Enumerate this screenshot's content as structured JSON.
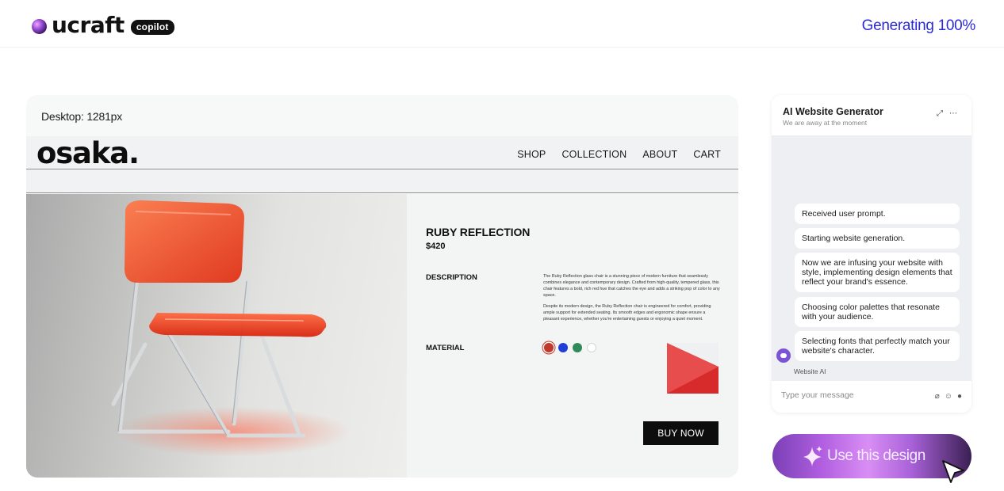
{
  "brand": {
    "name": "ucraft",
    "badge": "copilot"
  },
  "status": {
    "text": "Generating 100%"
  },
  "preview": {
    "label": "Desktop: 1281px",
    "site": {
      "logo": "osaka.",
      "nav": [
        "SHOP",
        "COLLECTION",
        "ABOUT",
        "CART"
      ]
    },
    "product": {
      "name": "RUBY REFLECTION",
      "price": "$420",
      "description_label": "DESCRIPTION",
      "description": [
        "The Ruby Reflection glass chair is a stunning piece of modern furniture that seamlessly combines elegance and contemporary design. Crafted from high-quality, tempered glass, this chair features a bold, rich red hue that catches the eye and adds a striking pop of color to any space.",
        "Despite its modern design, the Ruby Reflection chair is engineered for comfort, providing ample support for extended seating. Its smooth edges and ergonomic shape ensure a pleasant experience, whether you're entertaining guests or enjoying a quiet moment."
      ],
      "material_label": "MATERIAL",
      "swatches": [
        "#c0392b",
        "#1f3fd8",
        "#2e8b57",
        "#ffffff"
      ],
      "buy_label": "BUY NOW"
    }
  },
  "chat": {
    "title": "AI Website Generator",
    "subtitle": "We are away at the moment",
    "messages": [
      "Received user prompt.",
      "Starting website generation.",
      "Now we are infusing your website with style, implementing design elements that reflect your brand's essence.",
      "Choosing color palettes that resonate with your audience.",
      "Selecting fonts that perfectly match your website's character."
    ],
    "bot_name": "Website AI",
    "input_placeholder": "Type your message"
  },
  "cta": {
    "label": "Use this design"
  }
}
